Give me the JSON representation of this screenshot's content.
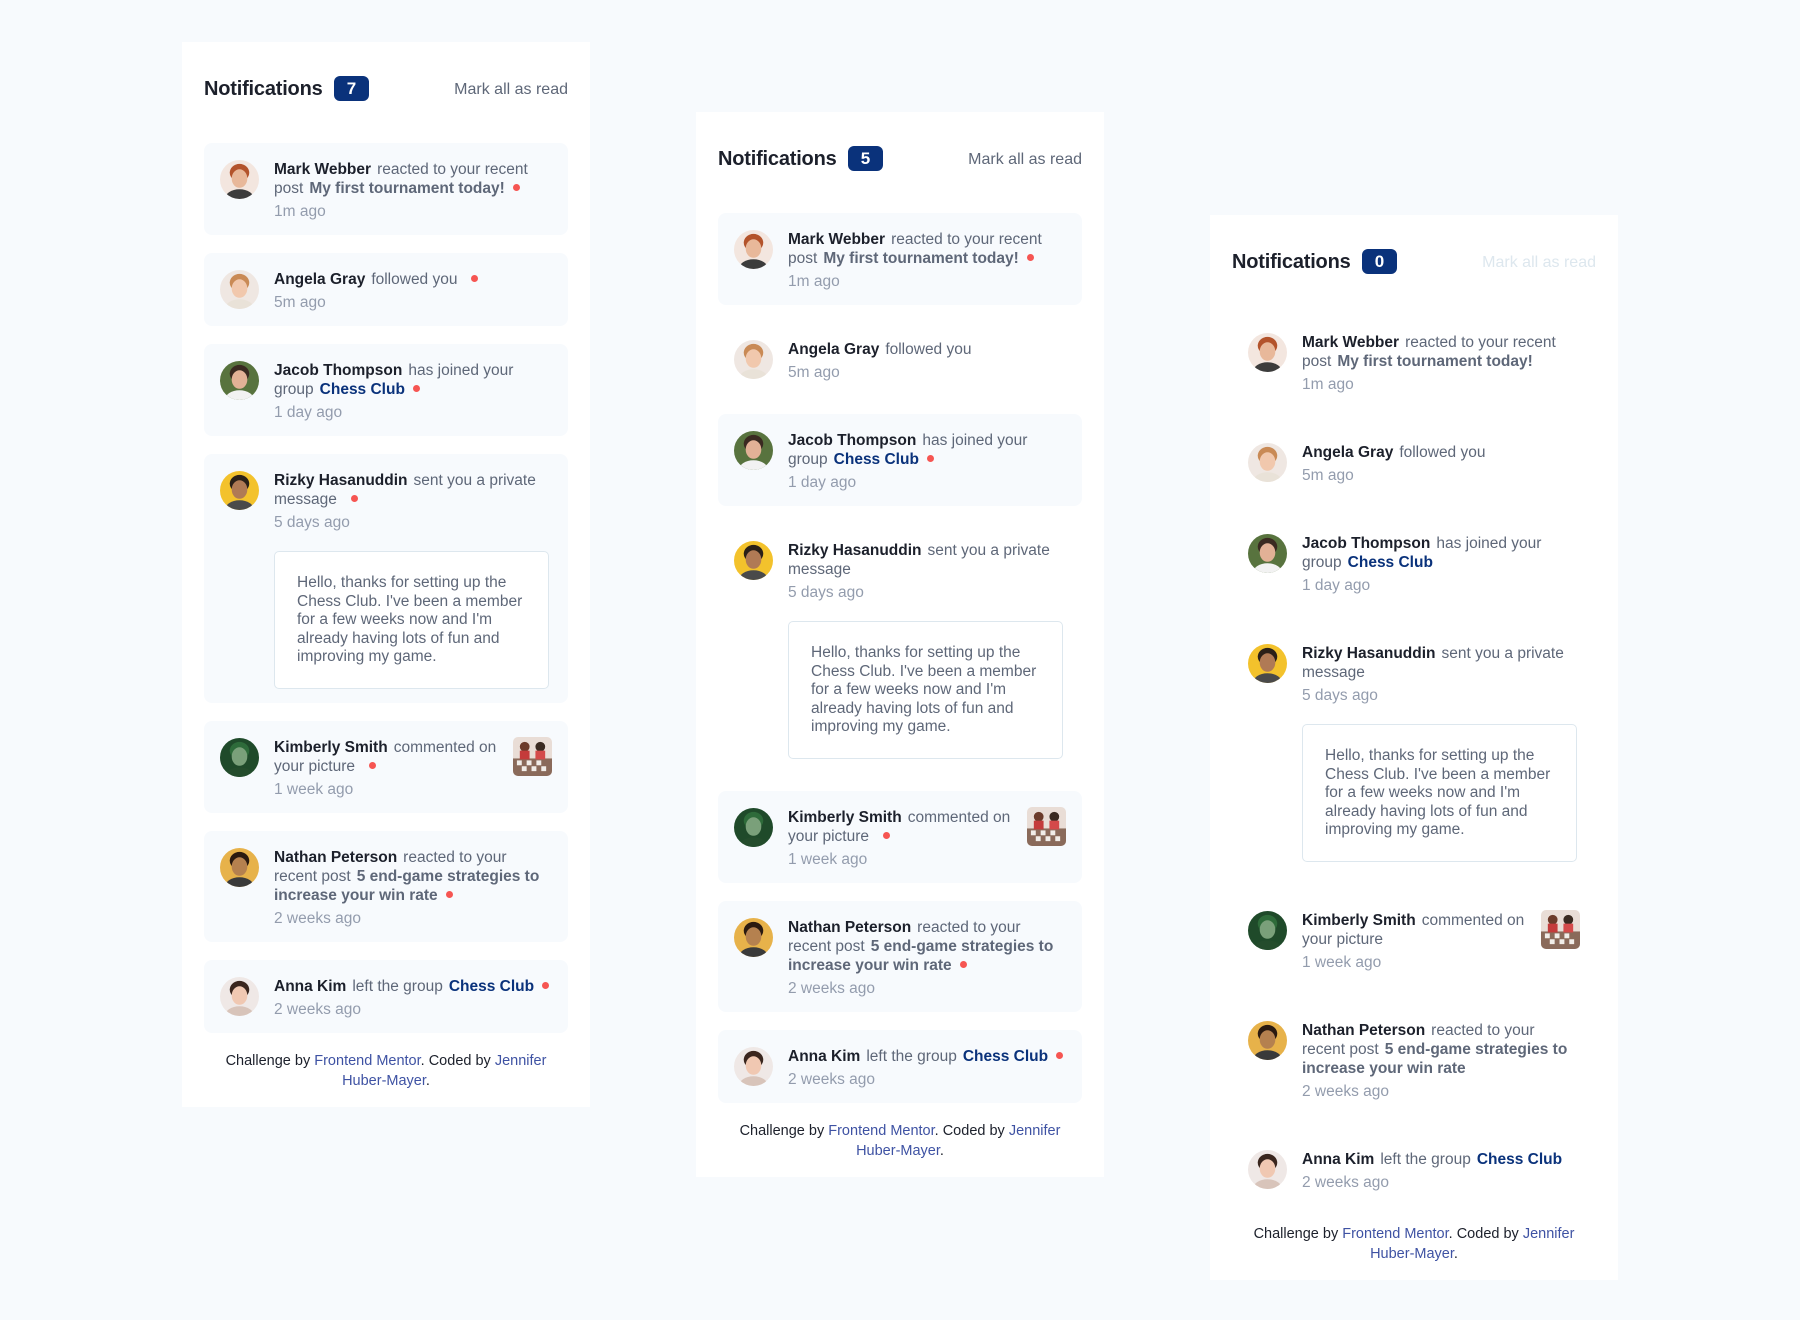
{
  "panels": [
    {
      "title": "Notifications",
      "count": "7",
      "mark_all": "Mark all as read",
      "mark_all_disabled": false,
      "items": [
        {
          "name": "Mark Webber",
          "action": "reacted to your recent post",
          "object": "My first tournament today!",
          "time": "1m ago",
          "unread": true,
          "avatar": "avatar-mark-webber"
        },
        {
          "name": "Angela Gray",
          "action": "followed you",
          "object": "",
          "time": "5m ago",
          "unread": true,
          "avatar": "avatar-angela-gray"
        },
        {
          "name": "Jacob Thompson",
          "action": "has joined your group",
          "object": "Chess Club",
          "time": "1 day ago",
          "unread": true,
          "avatar": "avatar-jacob-thompson"
        },
        {
          "name": "Rizky Hasanuddin",
          "action": "sent you a private message",
          "object": "",
          "time": "5 days ago",
          "unread": true,
          "avatar": "avatar-rizky-hasanuddin",
          "message": "Hello, thanks for setting up the Chess Club. I've been a member for a few weeks now and I'm already having lots of fun and improving my game."
        },
        {
          "name": "Kimberly Smith",
          "action": "commented on your picture",
          "object": "",
          "time": "1 week ago",
          "unread": true,
          "avatar": "avatar-kimberly-smith",
          "picture": "chess-picture"
        },
        {
          "name": "Nathan Peterson",
          "action": "reacted to your recent post",
          "object": "5 end-game strategies to increase your win rate",
          "time": "2 weeks ago",
          "unread": true,
          "avatar": "avatar-nathan-peterson"
        },
        {
          "name": "Anna Kim",
          "action": "left the group",
          "object": "Chess Club",
          "time": "2 weeks ago",
          "unread": true,
          "avatar": "avatar-anna-kim"
        }
      ],
      "attribution": {
        "prefix": "Challenge by",
        "fm": "Frontend Mentor",
        "mid": ". Coded by",
        "author": "Jennifer Huber-Mayer",
        "suffix": "."
      }
    },
    {
      "title": "Notifications",
      "count": "5",
      "mark_all": "Mark all as read",
      "mark_all_disabled": false,
      "items": [
        {
          "name": "Mark Webber",
          "action": "reacted to your recent post",
          "object": "My first tournament today!",
          "time": "1m ago",
          "unread": true,
          "avatar": "avatar-mark-webber"
        },
        {
          "name": "Angela Gray",
          "action": "followed you",
          "object": "",
          "time": "5m ago",
          "unread": false,
          "avatar": "avatar-angela-gray"
        },
        {
          "name": "Jacob Thompson",
          "action": "has joined your group",
          "object": "Chess Club",
          "time": "1 day ago",
          "unread": true,
          "avatar": "avatar-jacob-thompson"
        },
        {
          "name": "Rizky Hasanuddin",
          "action": "sent you a private message",
          "object": "",
          "time": "5 days ago",
          "unread": false,
          "avatar": "avatar-rizky-hasanuddin",
          "message": "Hello, thanks for setting up the Chess Club. I've been a member for a few weeks now and I'm already having lots of fun and improving my game."
        },
        {
          "name": "Kimberly Smith",
          "action": "commented on your picture",
          "object": "",
          "time": "1 week ago",
          "unread": true,
          "avatar": "avatar-kimberly-smith",
          "picture": "chess-picture"
        },
        {
          "name": "Nathan Peterson",
          "action": "reacted to your recent post",
          "object": "5 end-game strategies to increase your win rate",
          "time": "2 weeks ago",
          "unread": true,
          "avatar": "avatar-nathan-peterson"
        },
        {
          "name": "Anna Kim",
          "action": "left the group",
          "object": "Chess Club",
          "time": "2 weeks ago",
          "unread": true,
          "avatar": "avatar-anna-kim"
        }
      ],
      "attribution": {
        "prefix": "Challenge by",
        "fm": "Frontend Mentor",
        "mid": ". Coded by",
        "author": "Jennifer Huber-Mayer",
        "suffix": "."
      }
    },
    {
      "title": "Notifications",
      "count": "0",
      "mark_all": "Mark all as read",
      "mark_all_disabled": true,
      "items": [
        {
          "name": "Mark Webber",
          "action": "reacted to your recent post",
          "object": "My first tournament today!",
          "time": "1m ago",
          "unread": false,
          "avatar": "avatar-mark-webber"
        },
        {
          "name": "Angela Gray",
          "action": "followed you",
          "object": "",
          "time": "5m ago",
          "unread": false,
          "avatar": "avatar-angela-gray"
        },
        {
          "name": "Jacob Thompson",
          "action": "has joined your group",
          "object": "Chess Club",
          "time": "1 day ago",
          "unread": false,
          "avatar": "avatar-jacob-thompson"
        },
        {
          "name": "Rizky Hasanuddin",
          "action": "sent you a private message",
          "object": "",
          "time": "5 days ago",
          "unread": false,
          "avatar": "avatar-rizky-hasanuddin",
          "message": "Hello, thanks for setting up the Chess Club. I've been a member for a few weeks now and I'm already having lots of fun and improving my game."
        },
        {
          "name": "Kimberly Smith",
          "action": "commented on your picture",
          "object": "",
          "time": "1 week ago",
          "unread": false,
          "avatar": "avatar-kimberly-smith",
          "picture": "chess-picture"
        },
        {
          "name": "Nathan Peterson",
          "action": "reacted to your recent post",
          "object": "5 end-game strategies to increase your win rate",
          "time": "2 weeks ago",
          "unread": false,
          "avatar": "avatar-nathan-peterson"
        },
        {
          "name": "Anna Kim",
          "action": "left the group",
          "object": "Chess Club",
          "time": "2 weeks ago",
          "unread": false,
          "avatar": "avatar-anna-kim"
        }
      ],
      "attribution": {
        "prefix": "Challenge by",
        "fm": "Frontend Mentor",
        "mid": ". Coded by",
        "author": "Jennifer Huber-Mayer",
        "suffix": "."
      }
    }
  ],
  "colors": {
    "badge": "#0a327b",
    "unread_bg": "#f7fafd",
    "dot": "#f65552",
    "link": "#3e52a3",
    "dark_text": "#1c202b",
    "muted_text": "#939cad"
  }
}
